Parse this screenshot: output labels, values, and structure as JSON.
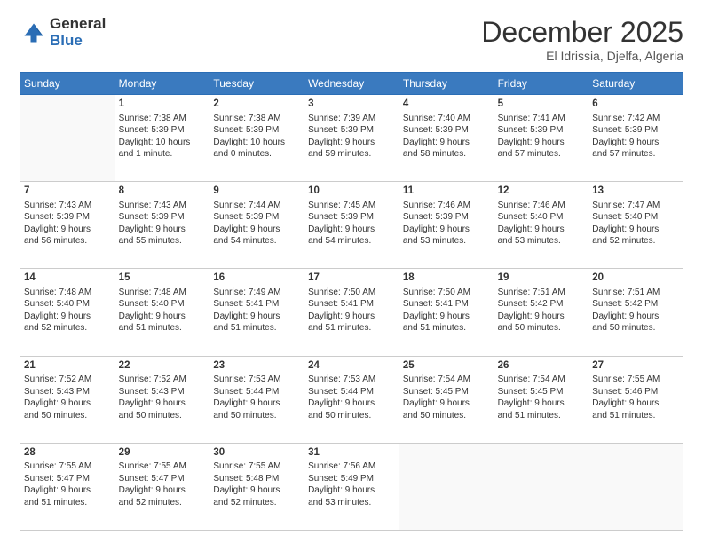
{
  "logo": {
    "general": "General",
    "blue": "Blue"
  },
  "title": "December 2025",
  "location": "El Idrissia, Djelfa, Algeria",
  "days_of_week": [
    "Sunday",
    "Monday",
    "Tuesday",
    "Wednesday",
    "Thursday",
    "Friday",
    "Saturday"
  ],
  "weeks": [
    [
      {
        "day": "",
        "info": ""
      },
      {
        "day": "1",
        "info": "Sunrise: 7:38 AM\nSunset: 5:39 PM\nDaylight: 10 hours\nand 1 minute."
      },
      {
        "day": "2",
        "info": "Sunrise: 7:38 AM\nSunset: 5:39 PM\nDaylight: 10 hours\nand 0 minutes."
      },
      {
        "day": "3",
        "info": "Sunrise: 7:39 AM\nSunset: 5:39 PM\nDaylight: 9 hours\nand 59 minutes."
      },
      {
        "day": "4",
        "info": "Sunrise: 7:40 AM\nSunset: 5:39 PM\nDaylight: 9 hours\nand 58 minutes."
      },
      {
        "day": "5",
        "info": "Sunrise: 7:41 AM\nSunset: 5:39 PM\nDaylight: 9 hours\nand 57 minutes."
      },
      {
        "day": "6",
        "info": "Sunrise: 7:42 AM\nSunset: 5:39 PM\nDaylight: 9 hours\nand 57 minutes."
      }
    ],
    [
      {
        "day": "7",
        "info": "Sunrise: 7:43 AM\nSunset: 5:39 PM\nDaylight: 9 hours\nand 56 minutes."
      },
      {
        "day": "8",
        "info": "Sunrise: 7:43 AM\nSunset: 5:39 PM\nDaylight: 9 hours\nand 55 minutes."
      },
      {
        "day": "9",
        "info": "Sunrise: 7:44 AM\nSunset: 5:39 PM\nDaylight: 9 hours\nand 54 minutes."
      },
      {
        "day": "10",
        "info": "Sunrise: 7:45 AM\nSunset: 5:39 PM\nDaylight: 9 hours\nand 54 minutes."
      },
      {
        "day": "11",
        "info": "Sunrise: 7:46 AM\nSunset: 5:39 PM\nDaylight: 9 hours\nand 53 minutes."
      },
      {
        "day": "12",
        "info": "Sunrise: 7:46 AM\nSunset: 5:40 PM\nDaylight: 9 hours\nand 53 minutes."
      },
      {
        "day": "13",
        "info": "Sunrise: 7:47 AM\nSunset: 5:40 PM\nDaylight: 9 hours\nand 52 minutes."
      }
    ],
    [
      {
        "day": "14",
        "info": "Sunrise: 7:48 AM\nSunset: 5:40 PM\nDaylight: 9 hours\nand 52 minutes."
      },
      {
        "day": "15",
        "info": "Sunrise: 7:48 AM\nSunset: 5:40 PM\nDaylight: 9 hours\nand 51 minutes."
      },
      {
        "day": "16",
        "info": "Sunrise: 7:49 AM\nSunset: 5:41 PM\nDaylight: 9 hours\nand 51 minutes."
      },
      {
        "day": "17",
        "info": "Sunrise: 7:50 AM\nSunset: 5:41 PM\nDaylight: 9 hours\nand 51 minutes."
      },
      {
        "day": "18",
        "info": "Sunrise: 7:50 AM\nSunset: 5:41 PM\nDaylight: 9 hours\nand 51 minutes."
      },
      {
        "day": "19",
        "info": "Sunrise: 7:51 AM\nSunset: 5:42 PM\nDaylight: 9 hours\nand 50 minutes."
      },
      {
        "day": "20",
        "info": "Sunrise: 7:51 AM\nSunset: 5:42 PM\nDaylight: 9 hours\nand 50 minutes."
      }
    ],
    [
      {
        "day": "21",
        "info": "Sunrise: 7:52 AM\nSunset: 5:43 PM\nDaylight: 9 hours\nand 50 minutes."
      },
      {
        "day": "22",
        "info": "Sunrise: 7:52 AM\nSunset: 5:43 PM\nDaylight: 9 hours\nand 50 minutes."
      },
      {
        "day": "23",
        "info": "Sunrise: 7:53 AM\nSunset: 5:44 PM\nDaylight: 9 hours\nand 50 minutes."
      },
      {
        "day": "24",
        "info": "Sunrise: 7:53 AM\nSunset: 5:44 PM\nDaylight: 9 hours\nand 50 minutes."
      },
      {
        "day": "25",
        "info": "Sunrise: 7:54 AM\nSunset: 5:45 PM\nDaylight: 9 hours\nand 50 minutes."
      },
      {
        "day": "26",
        "info": "Sunrise: 7:54 AM\nSunset: 5:45 PM\nDaylight: 9 hours\nand 51 minutes."
      },
      {
        "day": "27",
        "info": "Sunrise: 7:55 AM\nSunset: 5:46 PM\nDaylight: 9 hours\nand 51 minutes."
      }
    ],
    [
      {
        "day": "28",
        "info": "Sunrise: 7:55 AM\nSunset: 5:47 PM\nDaylight: 9 hours\nand 51 minutes."
      },
      {
        "day": "29",
        "info": "Sunrise: 7:55 AM\nSunset: 5:47 PM\nDaylight: 9 hours\nand 52 minutes."
      },
      {
        "day": "30",
        "info": "Sunrise: 7:55 AM\nSunset: 5:48 PM\nDaylight: 9 hours\nand 52 minutes."
      },
      {
        "day": "31",
        "info": "Sunrise: 7:56 AM\nSunset: 5:49 PM\nDaylight: 9 hours\nand 53 minutes."
      },
      {
        "day": "",
        "info": ""
      },
      {
        "day": "",
        "info": ""
      },
      {
        "day": "",
        "info": ""
      }
    ]
  ]
}
